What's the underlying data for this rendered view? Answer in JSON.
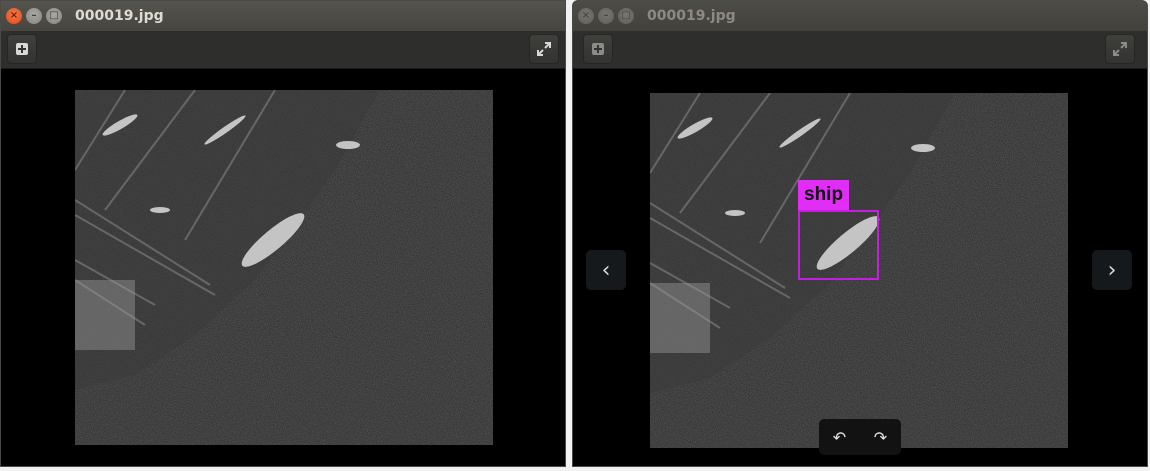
{
  "windows": [
    {
      "id": "left",
      "title": "000019.jpg",
      "state": "active"
    },
    {
      "id": "right",
      "title": "000019.jpg",
      "state": "inactive",
      "detection": {
        "label": "ship",
        "color": "#e02ef6"
      }
    }
  ],
  "window_buttons": {
    "close": "×",
    "minimize": "–",
    "maximize": "□"
  },
  "toolbar": {
    "zoom_icon": "plus-box-icon",
    "fullscreen_icon": "expand-icon"
  },
  "navigation": {
    "prev": "‹",
    "next": "›",
    "rotate_left": "↶",
    "rotate_right": "↷"
  },
  "image": {
    "description_icon": "sar-image",
    "colors": {
      "background": "#000000",
      "ship_box": "#c41ee0"
    }
  }
}
